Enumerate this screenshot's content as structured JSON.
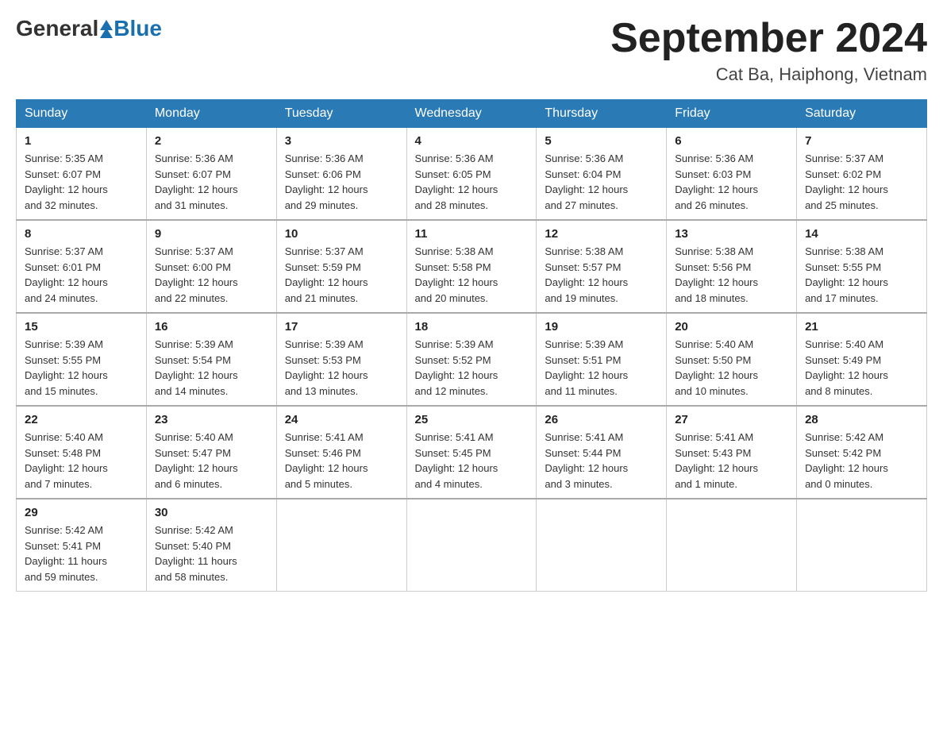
{
  "header": {
    "logo_general": "General",
    "logo_blue": "Blue",
    "title": "September 2024",
    "subtitle": "Cat Ba, Haiphong, Vietnam"
  },
  "days_of_week": [
    "Sunday",
    "Monday",
    "Tuesday",
    "Wednesday",
    "Thursday",
    "Friday",
    "Saturday"
  ],
  "weeks": [
    [
      {
        "num": "1",
        "sunrise": "5:35 AM",
        "sunset": "6:07 PM",
        "daylight": "12 hours and 32 minutes."
      },
      {
        "num": "2",
        "sunrise": "5:36 AM",
        "sunset": "6:07 PM",
        "daylight": "12 hours and 31 minutes."
      },
      {
        "num": "3",
        "sunrise": "5:36 AM",
        "sunset": "6:06 PM",
        "daylight": "12 hours and 29 minutes."
      },
      {
        "num": "4",
        "sunrise": "5:36 AM",
        "sunset": "6:05 PM",
        "daylight": "12 hours and 28 minutes."
      },
      {
        "num": "5",
        "sunrise": "5:36 AM",
        "sunset": "6:04 PM",
        "daylight": "12 hours and 27 minutes."
      },
      {
        "num": "6",
        "sunrise": "5:36 AM",
        "sunset": "6:03 PM",
        "daylight": "12 hours and 26 minutes."
      },
      {
        "num": "7",
        "sunrise": "5:37 AM",
        "sunset": "6:02 PM",
        "daylight": "12 hours and 25 minutes."
      }
    ],
    [
      {
        "num": "8",
        "sunrise": "5:37 AM",
        "sunset": "6:01 PM",
        "daylight": "12 hours and 24 minutes."
      },
      {
        "num": "9",
        "sunrise": "5:37 AM",
        "sunset": "6:00 PM",
        "daylight": "12 hours and 22 minutes."
      },
      {
        "num": "10",
        "sunrise": "5:37 AM",
        "sunset": "5:59 PM",
        "daylight": "12 hours and 21 minutes."
      },
      {
        "num": "11",
        "sunrise": "5:38 AM",
        "sunset": "5:58 PM",
        "daylight": "12 hours and 20 minutes."
      },
      {
        "num": "12",
        "sunrise": "5:38 AM",
        "sunset": "5:57 PM",
        "daylight": "12 hours and 19 minutes."
      },
      {
        "num": "13",
        "sunrise": "5:38 AM",
        "sunset": "5:56 PM",
        "daylight": "12 hours and 18 minutes."
      },
      {
        "num": "14",
        "sunrise": "5:38 AM",
        "sunset": "5:55 PM",
        "daylight": "12 hours and 17 minutes."
      }
    ],
    [
      {
        "num": "15",
        "sunrise": "5:39 AM",
        "sunset": "5:55 PM",
        "daylight": "12 hours and 15 minutes."
      },
      {
        "num": "16",
        "sunrise": "5:39 AM",
        "sunset": "5:54 PM",
        "daylight": "12 hours and 14 minutes."
      },
      {
        "num": "17",
        "sunrise": "5:39 AM",
        "sunset": "5:53 PM",
        "daylight": "12 hours and 13 minutes."
      },
      {
        "num": "18",
        "sunrise": "5:39 AM",
        "sunset": "5:52 PM",
        "daylight": "12 hours and 12 minutes."
      },
      {
        "num": "19",
        "sunrise": "5:39 AM",
        "sunset": "5:51 PM",
        "daylight": "12 hours and 11 minutes."
      },
      {
        "num": "20",
        "sunrise": "5:40 AM",
        "sunset": "5:50 PM",
        "daylight": "12 hours and 10 minutes."
      },
      {
        "num": "21",
        "sunrise": "5:40 AM",
        "sunset": "5:49 PM",
        "daylight": "12 hours and 8 minutes."
      }
    ],
    [
      {
        "num": "22",
        "sunrise": "5:40 AM",
        "sunset": "5:48 PM",
        "daylight": "12 hours and 7 minutes."
      },
      {
        "num": "23",
        "sunrise": "5:40 AM",
        "sunset": "5:47 PM",
        "daylight": "12 hours and 6 minutes."
      },
      {
        "num": "24",
        "sunrise": "5:41 AM",
        "sunset": "5:46 PM",
        "daylight": "12 hours and 5 minutes."
      },
      {
        "num": "25",
        "sunrise": "5:41 AM",
        "sunset": "5:45 PM",
        "daylight": "12 hours and 4 minutes."
      },
      {
        "num": "26",
        "sunrise": "5:41 AM",
        "sunset": "5:44 PM",
        "daylight": "12 hours and 3 minutes."
      },
      {
        "num": "27",
        "sunrise": "5:41 AM",
        "sunset": "5:43 PM",
        "daylight": "12 hours and 1 minute."
      },
      {
        "num": "28",
        "sunrise": "5:42 AM",
        "sunset": "5:42 PM",
        "daylight": "12 hours and 0 minutes."
      }
    ],
    [
      {
        "num": "29",
        "sunrise": "5:42 AM",
        "sunset": "5:41 PM",
        "daylight": "11 hours and 59 minutes."
      },
      {
        "num": "30",
        "sunrise": "5:42 AM",
        "sunset": "5:40 PM",
        "daylight": "11 hours and 58 minutes."
      },
      null,
      null,
      null,
      null,
      null
    ]
  ],
  "labels": {
    "sunrise": "Sunrise:",
    "sunset": "Sunset:",
    "daylight": "Daylight:"
  }
}
